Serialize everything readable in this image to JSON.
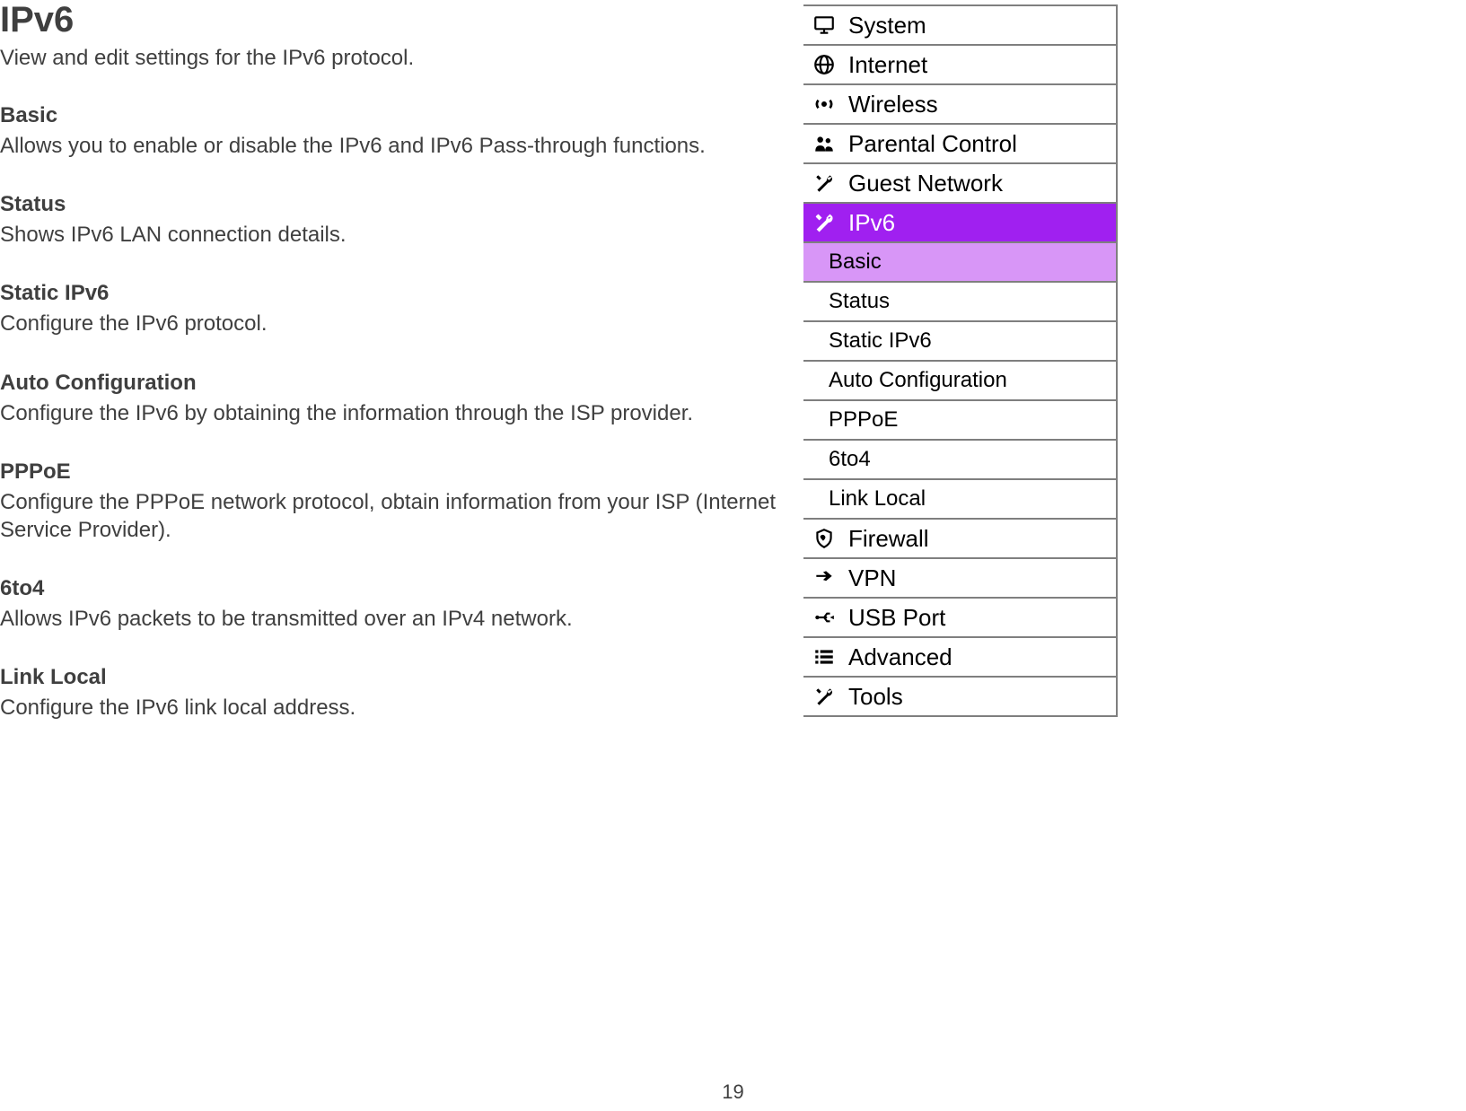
{
  "page": {
    "title": "IPv6",
    "subtitle": "View and edit settings for the IPv6 protocol.",
    "sections": [
      {
        "heading": "Basic",
        "body": "Allows you to enable or disable the IPv6 and IPv6 Pass-through functions."
      },
      {
        "heading": "Status",
        "body": "Shows IPv6 LAN connection details."
      },
      {
        "heading": "Static IPv6",
        "body": "Configure the IPv6 protocol."
      },
      {
        "heading": "Auto Configuration",
        "body": "Configure the IPv6 by obtaining the information through the ISP provider."
      },
      {
        "heading": "PPPoE",
        "body": "Configure the PPPoE network protocol, obtain information from your ISP (Internet Service Provider)."
      },
      {
        "heading": "6to4",
        "body": "Allows IPv6 packets to be transmitted over an IPv4 network."
      },
      {
        "heading": "Link Local",
        "body": "Configure the IPv6 link local address."
      }
    ],
    "page_number": "19"
  },
  "sidebar": {
    "items": [
      {
        "label": "System",
        "icon": "monitor-icon"
      },
      {
        "label": "Internet",
        "icon": "globe-icon"
      },
      {
        "label": "Wireless",
        "icon": "wifi-icon"
      },
      {
        "label": "Parental Control",
        "icon": "people-icon"
      },
      {
        "label": "Guest Network",
        "icon": "wrench-icon"
      },
      {
        "label": "IPv6",
        "icon": "wrench-icon",
        "active": true,
        "subitems": [
          {
            "label": "Basic",
            "selected": true
          },
          {
            "label": "Status"
          },
          {
            "label": "Static IPv6"
          },
          {
            "label": "Auto Configuration"
          },
          {
            "label": "PPPoE"
          },
          {
            "label": "6to4"
          },
          {
            "label": "Link Local"
          }
        ]
      },
      {
        "label": "Firewall",
        "icon": "shield-icon"
      },
      {
        "label": "VPN",
        "icon": "arrow-icon"
      },
      {
        "label": "USB Port",
        "icon": "usb-icon"
      },
      {
        "label": "Advanced",
        "icon": "list-icon"
      },
      {
        "label": "Tools",
        "icon": "wrench-icon"
      }
    ]
  }
}
